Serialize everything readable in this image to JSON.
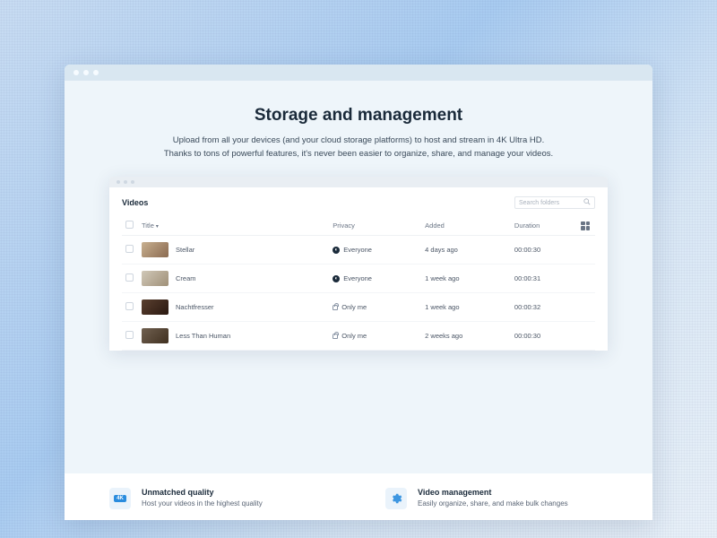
{
  "hero": {
    "title": "Storage and management",
    "subtitle": "Upload from all your devices (and your cloud storage platforms) to host and stream in 4K Ultra HD. Thanks to tons of powerful features, it's never been easier to organize, share, and manage your videos."
  },
  "panel": {
    "heading": "Videos",
    "search_placeholder": "Search folders",
    "columns": {
      "title": "Title",
      "privacy": "Privacy",
      "added": "Added",
      "duration": "Duration"
    },
    "sort_indicator": "▾"
  },
  "privacy_labels": {
    "everyone": "Everyone",
    "only_me": "Only me"
  },
  "videos": [
    {
      "title": "Stellar",
      "privacy": "everyone",
      "added": "4 days ago",
      "duration": "00:00:30",
      "thumb": "t1"
    },
    {
      "title": "Cream",
      "privacy": "everyone",
      "added": "1 week ago",
      "duration": "00:00:31",
      "thumb": "t2"
    },
    {
      "title": "Nachtfresser",
      "privacy": "only_me",
      "added": "1 week ago",
      "duration": "00:00:32",
      "thumb": "t3"
    },
    {
      "title": "Less Than Human",
      "privacy": "only_me",
      "added": "2 weeks ago",
      "duration": "00:00:30",
      "thumb": "t4"
    }
  ],
  "features": [
    {
      "icon": "4k",
      "title": "Unmatched quality",
      "desc": "Host your videos in the highest quality"
    },
    {
      "icon": "gear",
      "title": "Video management",
      "desc": "Easily organize, share, and make bulk changes"
    }
  ],
  "icons": {
    "4k_label": "4K"
  }
}
